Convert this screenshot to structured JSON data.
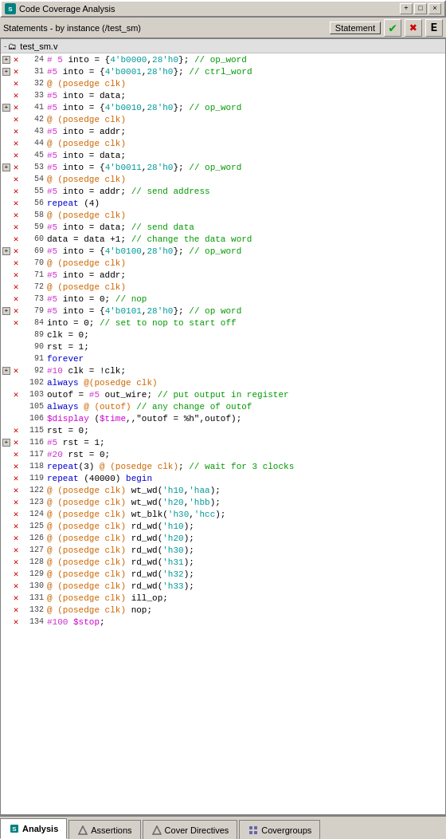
{
  "titleBar": {
    "icon": "S",
    "title": "Code Coverage Analysis",
    "buttons": [
      "+",
      "□",
      "×"
    ]
  },
  "toolbar": {
    "label": "Statements - by instance (/test_sm)",
    "statementBtn": "Statement",
    "checkIcon": "✔",
    "crossIcon": "✖",
    "eIcon": "E"
  },
  "tree": {
    "rootNode": "test_sm.v",
    "expandLabel": "-"
  },
  "codeLines": [
    {
      "hasExpand": true,
      "hasX": true,
      "lineNum": "24",
      "code": "# 5 into = {4'b0000,28'h0}; // op_word",
      "parts": [
        {
          "t": "hash",
          "v": "# 5"
        },
        {
          "t": "n",
          "v": " into = {"
        },
        {
          "t": "teal",
          "v": "4'b0000"
        },
        {
          "t": "n",
          "v": ","
        },
        {
          "t": "teal",
          "v": "28'h0"
        },
        {
          "t": "n",
          "v": "}; "
        },
        {
          "t": "green",
          "v": "// op_word"
        }
      ]
    },
    {
      "hasExpand": true,
      "hasX": true,
      "lineNum": "31",
      "code": "#5 into = {4'b0001,28'h0}; // ctrl_word",
      "parts": [
        {
          "t": "hash",
          "v": "#5"
        },
        {
          "t": "n",
          "v": " into = {"
        },
        {
          "t": "teal",
          "v": "4'b0001"
        },
        {
          "t": "n",
          "v": ","
        },
        {
          "t": "teal",
          "v": "28'h0"
        },
        {
          "t": "n",
          "v": "}; "
        },
        {
          "t": "green",
          "v": "// ctrl_word"
        }
      ]
    },
    {
      "hasExpand": false,
      "hasX": true,
      "lineNum": "32",
      "code": "@ (posedge clk)",
      "parts": [
        {
          "t": "orange",
          "v": "@ (posedge clk)"
        }
      ]
    },
    {
      "hasExpand": false,
      "hasX": true,
      "lineNum": "33",
      "code": "#5 into = data;",
      "parts": [
        {
          "t": "hash",
          "v": "#5"
        },
        {
          "t": "n",
          "v": " into = data;"
        }
      ]
    },
    {
      "hasExpand": true,
      "hasX": true,
      "lineNum": "41",
      "code": "#5 into = {4'b0010,28'h0}; // op_word",
      "parts": [
        {
          "t": "hash",
          "v": "#5"
        },
        {
          "t": "n",
          "v": " into = {"
        },
        {
          "t": "teal",
          "v": "4'b0010"
        },
        {
          "t": "n",
          "v": ","
        },
        {
          "t": "teal",
          "v": "28'h0"
        },
        {
          "t": "n",
          "v": "}; "
        },
        {
          "t": "green",
          "v": "// op_word"
        }
      ]
    },
    {
      "hasExpand": false,
      "hasX": true,
      "lineNum": "42",
      "code": "@ (posedge clk)",
      "parts": [
        {
          "t": "orange",
          "v": "@ (posedge clk)"
        }
      ]
    },
    {
      "hasExpand": false,
      "hasX": true,
      "lineNum": "43",
      "code": "#5 into = addr;",
      "parts": [
        {
          "t": "hash",
          "v": "#5"
        },
        {
          "t": "n",
          "v": " into = addr;"
        }
      ]
    },
    {
      "hasExpand": false,
      "hasX": true,
      "lineNum": "44",
      "code": "@ (posedge clk)",
      "parts": [
        {
          "t": "orange",
          "v": "@ (posedge clk)"
        }
      ]
    },
    {
      "hasExpand": false,
      "hasX": true,
      "lineNum": "45",
      "code": "#5 into = data;",
      "parts": [
        {
          "t": "hash",
          "v": "#5"
        },
        {
          "t": "n",
          "v": " into = data;"
        }
      ]
    },
    {
      "hasExpand": true,
      "hasX": true,
      "lineNum": "53",
      "code": "#5 into = {4'b0011,28'h0}; // op_word",
      "parts": [
        {
          "t": "hash",
          "v": "#5"
        },
        {
          "t": "n",
          "v": " into = {"
        },
        {
          "t": "teal",
          "v": "4'b0011"
        },
        {
          "t": "n",
          "v": ","
        },
        {
          "t": "teal",
          "v": "28'h0"
        },
        {
          "t": "n",
          "v": "}; "
        },
        {
          "t": "green",
          "v": "// op_word"
        }
      ]
    },
    {
      "hasExpand": false,
      "hasX": true,
      "lineNum": "54",
      "code": "@ (posedge clk)",
      "parts": [
        {
          "t": "orange",
          "v": "@ (posedge clk)"
        }
      ]
    },
    {
      "hasExpand": false,
      "hasX": true,
      "lineNum": "55",
      "code": "#5 into = addr; // send address",
      "parts": [
        {
          "t": "hash",
          "v": "#5"
        },
        {
          "t": "n",
          "v": " into = addr; "
        },
        {
          "t": "green",
          "v": "// send address"
        }
      ]
    },
    {
      "hasExpand": false,
      "hasX": true,
      "lineNum": "56",
      "code": "repeat (4)",
      "parts": [
        {
          "t": "blue",
          "v": "repeat"
        },
        {
          "t": "n",
          "v": " (4)"
        }
      ]
    },
    {
      "hasExpand": false,
      "hasX": true,
      "lineNum": "58",
      "code": "@ (posedge clk)",
      "parts": [
        {
          "t": "orange",
          "v": "@ (posedge clk)"
        }
      ]
    },
    {
      "hasExpand": false,
      "hasX": true,
      "lineNum": "59",
      "code": "#5 into = data; // send data",
      "parts": [
        {
          "t": "hash",
          "v": "#5"
        },
        {
          "t": "n",
          "v": " into = data; "
        },
        {
          "t": "green",
          "v": "// send data"
        }
      ]
    },
    {
      "hasExpand": false,
      "hasX": true,
      "lineNum": "60",
      "code": "data = data +1; // change the data word",
      "parts": [
        {
          "t": "n",
          "v": "data = data +1; "
        },
        {
          "t": "green",
          "v": "// change the data word"
        }
      ]
    },
    {
      "hasExpand": true,
      "hasX": true,
      "lineNum": "69",
      "code": "#5 into = {4'b0100,28'h0}; // op_word",
      "parts": [
        {
          "t": "hash",
          "v": "#5"
        },
        {
          "t": "n",
          "v": " into = {"
        },
        {
          "t": "teal",
          "v": "4'b0100"
        },
        {
          "t": "n",
          "v": ","
        },
        {
          "t": "teal",
          "v": "28'h0"
        },
        {
          "t": "n",
          "v": "}; "
        },
        {
          "t": "green",
          "v": "// op_word"
        }
      ]
    },
    {
      "hasExpand": false,
      "hasX": true,
      "lineNum": "70",
      "code": "@ (posedge clk)",
      "parts": [
        {
          "t": "orange",
          "v": "@ (posedge clk)"
        }
      ]
    },
    {
      "hasExpand": false,
      "hasX": true,
      "lineNum": "71",
      "code": "#5 into = addr;",
      "parts": [
        {
          "t": "hash",
          "v": "#5"
        },
        {
          "t": "n",
          "v": " into = addr;"
        }
      ]
    },
    {
      "hasExpand": false,
      "hasX": true,
      "lineNum": "72",
      "code": "@ (posedge clk)",
      "parts": [
        {
          "t": "orange",
          "v": "@ (posedge clk)"
        }
      ]
    },
    {
      "hasExpand": false,
      "hasX": true,
      "lineNum": "73",
      "code": "#5 into = 0;  // nop",
      "parts": [
        {
          "t": "hash",
          "v": "#5"
        },
        {
          "t": "n",
          "v": " into = 0;  "
        },
        {
          "t": "green",
          "v": "// nop"
        }
      ]
    },
    {
      "hasExpand": true,
      "hasX": true,
      "lineNum": "79",
      "code": "#5 into = {4'b0101,28'h0};  // op word",
      "parts": [
        {
          "t": "hash",
          "v": "#5"
        },
        {
          "t": "n",
          "v": " into = {"
        },
        {
          "t": "teal",
          "v": "4'b0101"
        },
        {
          "t": "n",
          "v": ","
        },
        {
          "t": "teal",
          "v": "28'h0"
        },
        {
          "t": "n",
          "v": "};  "
        },
        {
          "t": "green",
          "v": "// op word"
        }
      ]
    },
    {
      "hasExpand": false,
      "hasX": true,
      "lineNum": "84",
      "code": "into = 0; // set to nop to start off",
      "parts": [
        {
          "t": "n",
          "v": "into = 0; "
        },
        {
          "t": "green",
          "v": "// set to nop to start off"
        }
      ]
    },
    {
      "hasExpand": false,
      "hasX": false,
      "lineNum": "89",
      "code": "clk = 0;",
      "parts": [
        {
          "t": "n",
          "v": "clk = 0;"
        }
      ]
    },
    {
      "hasExpand": false,
      "hasX": false,
      "lineNum": "90",
      "code": "rst = 1;",
      "parts": [
        {
          "t": "n",
          "v": "rst = 1;"
        }
      ]
    },
    {
      "hasExpand": false,
      "hasX": false,
      "lineNum": "91",
      "code": "forever",
      "parts": [
        {
          "t": "blue",
          "v": "forever"
        }
      ]
    },
    {
      "hasExpand": true,
      "hasX": true,
      "lineNum": "92",
      "code": "#10 clk = !clk;",
      "parts": [
        {
          "t": "hash",
          "v": "#10"
        },
        {
          "t": "n",
          "v": " clk = !clk;"
        }
      ]
    },
    {
      "hasExpand": false,
      "hasX": false,
      "lineNum": "102",
      "code": "always @(posedge clk)",
      "parts": [
        {
          "t": "blue",
          "v": "always"
        },
        {
          "t": "orange",
          "v": " @(posedge clk)"
        }
      ]
    },
    {
      "hasExpand": false,
      "hasX": true,
      "lineNum": "103",
      "code": "outof = #5 out_wire; // put output in register",
      "parts": [
        {
          "t": "n",
          "v": "outof = "
        },
        {
          "t": "hash",
          "v": "#5"
        },
        {
          "t": "n",
          "v": " out_wire; "
        },
        {
          "t": "green",
          "v": "// put output in register"
        }
      ]
    },
    {
      "hasExpand": false,
      "hasX": false,
      "lineNum": "105",
      "code": "always @ (outof)  // any change of outof",
      "parts": [
        {
          "t": "blue",
          "v": "always"
        },
        {
          "t": "orange",
          "v": " @ (outof)"
        },
        {
          "t": "n",
          "v": "  "
        },
        {
          "t": "green",
          "v": "// any change of outof"
        }
      ]
    },
    {
      "hasExpand": false,
      "hasX": false,
      "lineNum": "106",
      "code": "$display ($time,,\"outof = %h\",outof);",
      "parts": [
        {
          "t": "system",
          "v": "$display"
        },
        {
          "t": "n",
          "v": " ("
        },
        {
          "t": "system",
          "v": "$time"
        },
        {
          "t": "n",
          "v": ",,\"outof = %h\",outof);"
        }
      ]
    },
    {
      "hasExpand": false,
      "hasX": true,
      "lineNum": "115",
      "code": "rst = 0;",
      "parts": [
        {
          "t": "n",
          "v": "rst = 0;"
        }
      ]
    },
    {
      "hasExpand": true,
      "hasX": true,
      "lineNum": "116",
      "code": "#5 rst = 1;",
      "parts": [
        {
          "t": "hash",
          "v": "#5"
        },
        {
          "t": "n",
          "v": " rst = 1;"
        }
      ]
    },
    {
      "hasExpand": false,
      "hasX": true,
      "lineNum": "117",
      "code": "#20 rst = 0;",
      "parts": [
        {
          "t": "hash",
          "v": "#20"
        },
        {
          "t": "n",
          "v": " rst = 0;"
        }
      ]
    },
    {
      "hasExpand": false,
      "hasX": true,
      "lineNum": "118",
      "code": "repeat(3) @ (posedge clk); // wait for 3 clocks",
      "parts": [
        {
          "t": "blue",
          "v": "repeat"
        },
        {
          "t": "n",
          "v": "(3) "
        },
        {
          "t": "orange",
          "v": "@ (posedge clk)"
        },
        {
          "t": "n",
          "v": "; "
        },
        {
          "t": "green",
          "v": "// wait for 3 clocks"
        }
      ]
    },
    {
      "hasExpand": false,
      "hasX": true,
      "lineNum": "119",
      "code": "repeat (40000) begin",
      "parts": [
        {
          "t": "blue",
          "v": "repeat"
        },
        {
          "t": "n",
          "v": " (40000) "
        },
        {
          "t": "blue",
          "v": "begin"
        }
      ]
    },
    {
      "hasExpand": false,
      "hasX": true,
      "lineNum": "122",
      "code": "@ (posedge clk) wt_wd('h10,'haa);",
      "parts": [
        {
          "t": "orange",
          "v": "@ (posedge clk)"
        },
        {
          "t": "n",
          "v": " wt_wd("
        },
        {
          "t": "teal",
          "v": "'h10"
        },
        {
          "t": "n",
          "v": ","
        },
        {
          "t": "teal",
          "v": "'haa"
        },
        {
          "t": "n",
          "v": ");"
        }
      ]
    },
    {
      "hasExpand": false,
      "hasX": true,
      "lineNum": "123",
      "code": "@ (posedge clk) wt_wd('h20,'hbb);",
      "parts": [
        {
          "t": "orange",
          "v": "@ (posedge clk)"
        },
        {
          "t": "n",
          "v": " wt_wd("
        },
        {
          "t": "teal",
          "v": "'h20"
        },
        {
          "t": "n",
          "v": ","
        },
        {
          "t": "teal",
          "v": "'hbb"
        },
        {
          "t": "n",
          "v": ");"
        }
      ]
    },
    {
      "hasExpand": false,
      "hasX": true,
      "lineNum": "124",
      "code": "@ (posedge clk) wt_blk('h30,'hcc);",
      "parts": [
        {
          "t": "orange",
          "v": "@ (posedge clk)"
        },
        {
          "t": "n",
          "v": " wt_blk("
        },
        {
          "t": "teal",
          "v": "'h30"
        },
        {
          "t": "n",
          "v": ","
        },
        {
          "t": "teal",
          "v": "'hcc"
        },
        {
          "t": "n",
          "v": ");"
        }
      ]
    },
    {
      "hasExpand": false,
      "hasX": true,
      "lineNum": "125",
      "code": "@ (posedge clk) rd_wd('h10);",
      "parts": [
        {
          "t": "orange",
          "v": "@ (posedge clk)"
        },
        {
          "t": "n",
          "v": " rd_wd("
        },
        {
          "t": "teal",
          "v": "'h10"
        },
        {
          "t": "n",
          "v": ");"
        }
      ]
    },
    {
      "hasExpand": false,
      "hasX": true,
      "lineNum": "126",
      "code": "@ (posedge clk) rd_wd('h20);",
      "parts": [
        {
          "t": "orange",
          "v": "@ (posedge clk)"
        },
        {
          "t": "n",
          "v": " rd_wd("
        },
        {
          "t": "teal",
          "v": "'h20"
        },
        {
          "t": "n",
          "v": ");"
        }
      ]
    },
    {
      "hasExpand": false,
      "hasX": true,
      "lineNum": "127",
      "code": "@ (posedge clk) rd_wd('h30);",
      "parts": [
        {
          "t": "orange",
          "v": "@ (posedge clk)"
        },
        {
          "t": "n",
          "v": " rd_wd("
        },
        {
          "t": "teal",
          "v": "'h30"
        },
        {
          "t": "n",
          "v": ");"
        }
      ]
    },
    {
      "hasExpand": false,
      "hasX": true,
      "lineNum": "128",
      "code": "@ (posedge clk) rd_wd('h31);",
      "parts": [
        {
          "t": "orange",
          "v": "@ (posedge clk)"
        },
        {
          "t": "n",
          "v": " rd_wd("
        },
        {
          "t": "teal",
          "v": "'h31"
        },
        {
          "t": "n",
          "v": ");"
        }
      ]
    },
    {
      "hasExpand": false,
      "hasX": true,
      "lineNum": "129",
      "code": "@ (posedge clk) rd_wd('h32);",
      "parts": [
        {
          "t": "orange",
          "v": "@ (posedge clk)"
        },
        {
          "t": "n",
          "v": " rd_wd("
        },
        {
          "t": "teal",
          "v": "'h32"
        },
        {
          "t": "n",
          "v": ");"
        }
      ]
    },
    {
      "hasExpand": false,
      "hasX": true,
      "lineNum": "130",
      "code": "@ (posedge clk) rd_wd('h33);",
      "parts": [
        {
          "t": "orange",
          "v": "@ (posedge clk)"
        },
        {
          "t": "n",
          "v": " rd_wd("
        },
        {
          "t": "teal",
          "v": "'h33"
        },
        {
          "t": "n",
          "v": ");"
        }
      ]
    },
    {
      "hasExpand": false,
      "hasX": true,
      "lineNum": "131",
      "code": "@ (posedge clk) ill_op;",
      "parts": [
        {
          "t": "orange",
          "v": "@ (posedge clk)"
        },
        {
          "t": "n",
          "v": " ill_op;"
        }
      ]
    },
    {
      "hasExpand": false,
      "hasX": true,
      "lineNum": "132",
      "code": "@ (posedge clk) nop;",
      "parts": [
        {
          "t": "orange",
          "v": "@ (posedge clk)"
        },
        {
          "t": "n",
          "v": " nop;"
        }
      ]
    },
    {
      "hasExpand": false,
      "hasX": true,
      "lineNum": "134",
      "code": "#100 $stop;",
      "parts": [
        {
          "t": "hash",
          "v": "#100"
        },
        {
          "t": "n",
          "v": " "
        },
        {
          "t": "system",
          "v": "$stop"
        },
        {
          "t": "n",
          "v": ";"
        }
      ]
    }
  ],
  "tabs": [
    {
      "id": "analysis",
      "label": "Analysis",
      "active": true,
      "icon": "S"
    },
    {
      "id": "assertions",
      "label": "Assertions",
      "active": false,
      "icon": "△"
    },
    {
      "id": "cover-directives",
      "label": "Cover Directives",
      "active": false,
      "icon": "△"
    },
    {
      "id": "covergroups",
      "label": "Covergroups",
      "active": false,
      "icon": "⊞"
    }
  ]
}
